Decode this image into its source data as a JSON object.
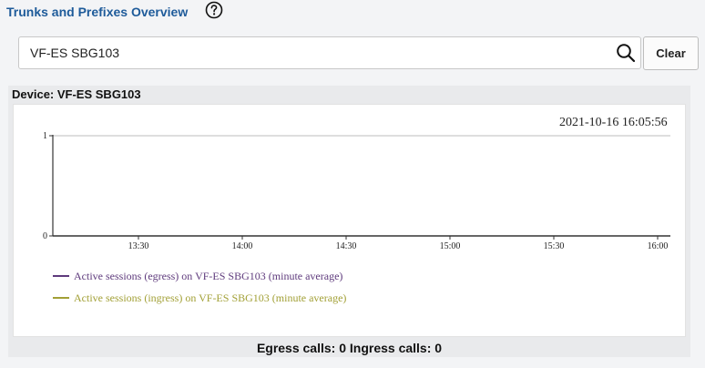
{
  "header": {
    "title": "Trunks and Prefixes Overview",
    "help_icon": "question-circle-icon"
  },
  "search": {
    "value": "VF-ES SBG103",
    "placeholder": "",
    "icon": "search-icon",
    "clear_label": "Clear"
  },
  "device": {
    "title": "Device: VF-ES SBG103"
  },
  "chart": {
    "timestamp": "2021-10-16 16:05:56",
    "legend": [
      {
        "label": "Active sessions (egress) on VF-ES SBG103 (minute average)",
        "color": "#5e3a7c"
      },
      {
        "label": "Active sessions (ingress) on VF-ES SBG103 (minute average)",
        "color": "#a2a036"
      }
    ]
  },
  "summary": {
    "text": "Egress calls: 0 Ingress calls: 0"
  },
  "chart_data": {
    "type": "line",
    "x": [
      "13:30",
      "14:00",
      "14:30",
      "15:00",
      "15:30",
      "16:00"
    ],
    "series": [
      {
        "name": "Active sessions (egress) on VF-ES SBG103 (minute average)",
        "values": []
      },
      {
        "name": "Active sessions (ingress) on VF-ES SBG103 (minute average)",
        "values": []
      }
    ],
    "yticks": [
      "0",
      "1"
    ],
    "ylim": [
      0,
      1
    ],
    "xlabel": "",
    "ylabel": "",
    "grid": false,
    "legend": "bottom-left"
  }
}
